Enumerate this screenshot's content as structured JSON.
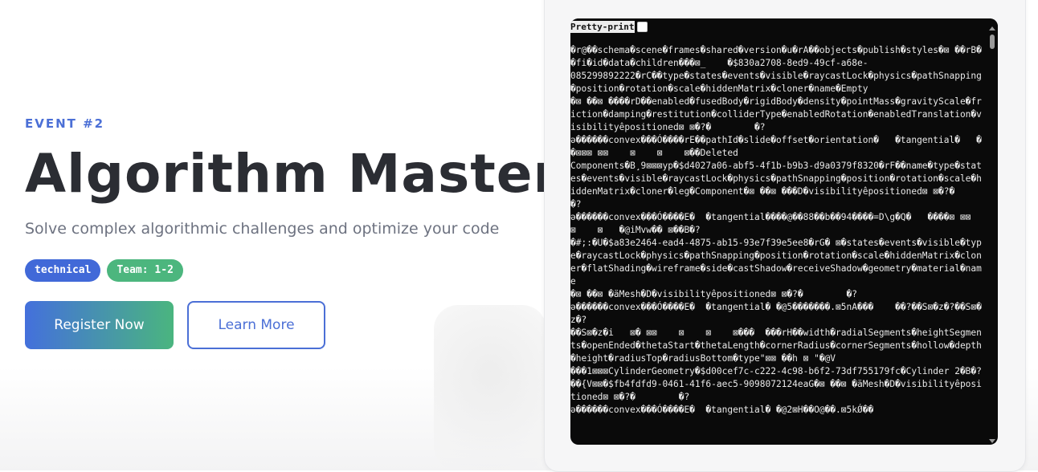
{
  "hero": {
    "event_label": "EVENT #2",
    "title": "Algorithm Master",
    "subtitle": "Solve complex algorithmic challenges and optimize your code",
    "tags": [
      "technical",
      "Team: 1-2"
    ],
    "register_label": "Register Now",
    "learn_more_label": "Learn More"
  },
  "viewer": {
    "pretty_print_label": "Pretty-print",
    "pretty_print_checked": false,
    "lines": [
      "�r@��schema�scene�frames�shared�version�u�rA��objects�publish�styles�⊠ ��rB��fi�id�data�children���⊠_    �$830a2708-8ed9-49cf-a68e-",
      "085299892222�rC��type�states�events�visible�raycastLock�physics�pathSnapping�position�rotation�scale�hiddenMatrix�cloner�name�Empty",
      "�⊠ ��⊠ ����rD��enabled�fusedBody�rigidBody�density�pointMass�gravityScale�friction�damping�restitution�colliderType�enabledRotation�enabledTranslation�visibilityêpositioned⊠ ⊠�?�        �?",
      "ə������convex���Ó����rE��pathId�slide�offset�orientation�   �tangential�   �    �⊠⊠⊠ ⊠⊠    ⊠    ⊠    ⊠��Deleted",
      "Components�B¸9⊠⊠⊠yp�$d4027a06-abf5-4f1b-b9b3-d9a0379f8320�rF��name�type�states�events�visible�raycastLock�physics�pathSnapping�position�rotation�scale�hiddenMatrix�cloner�leg�Component�⊠ ��⊠ ���D�visibilityêpositioned⊠ ⊠�?�        �?",
      "ə������convex���Ó����E�  �tangential����@��88��b��94����=D\\g�Q�   ����⊠ ⊠⊠    ⊠    ⊠   �@iMvw�� ⊠��B�?",
      "�#;:�U�$a83e2464-ead4-4875-ab15-93e7f39e5ee8�rG� ⊠�states�events�visible�type�raycastLock�physics�pathSnapping�position�rotation�scale�hiddenMatrix�cloner�flatShading�wireframe�side�castShadow�receiveShadow�geometry�material�name",
      "�⊠ ��⊠ �äMesh�D�visibilityêpositioned⊠ ⊠�?�        �?",
      "ə������convex���Ó����E�  �tangential� �@5�������.⊠5nA���    ��?��S⊠�z�?��S⊠�z�?",
      "��S⊠�z�i   ⊠� ⊠⊠    ⊠    ⊠    ⊠���  ���rH��width�radialSegments�heightSegments�openEnded�thetaStart�thetaLength�cornerRadius�cornerSegments�hollow�depth�height�radiusTop�radiusBottom�type\"⊠⊠ ��h ⊠ \"�@V",
      "���1⊠⊠⊠CylinderGeometry�$d00cef7c-c222-4c98-b6f2-73df755179fc�Cylinder 2�B�?��{V⊠⊠�$fb4fdfd9-0461-41f6-aec5-9098072124eaG�⊠ ��⊠ �äMesh�D�visibilityêpositioned⊠ ⊠�?�        �?",
      "ə������convex���Ó����E�  �tangential� �@2⊠H��O@��.⊠5kǾ��"
    ]
  },
  "colors": {
    "accent_blue": "#4b6fd6",
    "accent_green": "#4cb67e",
    "title_color": "#2b2d33"
  }
}
